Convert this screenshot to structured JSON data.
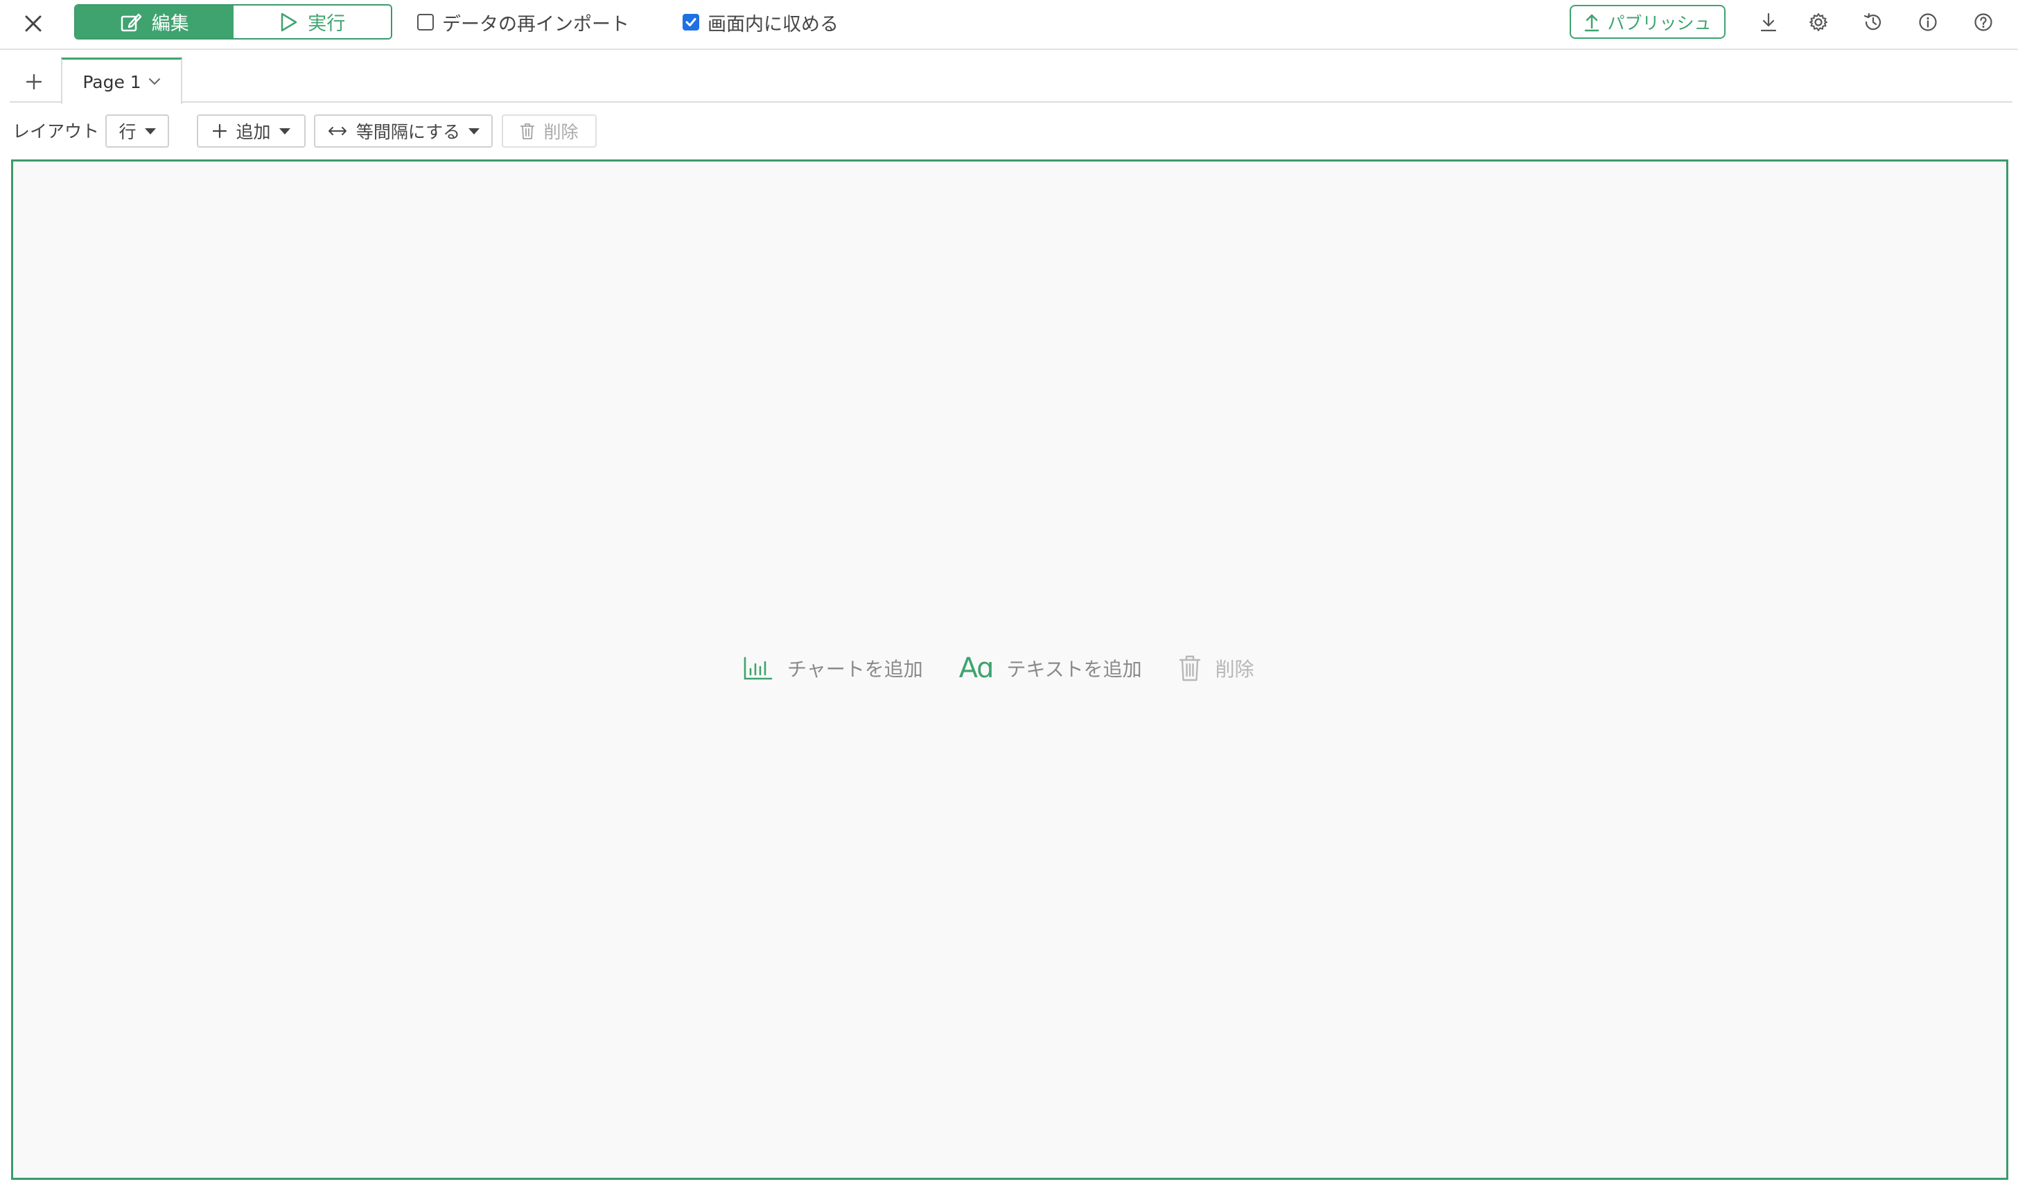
{
  "topbar": {
    "modes": [
      {
        "label": "編集",
        "active": true
      },
      {
        "label": "実行",
        "active": false
      }
    ],
    "reimport_label": "データの再インポート",
    "reimport_checked": false,
    "fit_label": "画面内に収める",
    "fit_checked": true,
    "publish_label": "パブリッシュ",
    "icons": [
      "download-icon",
      "gear-icon",
      "history-icon",
      "info-icon",
      "help-icon"
    ]
  },
  "tabs": {
    "items": [
      {
        "label": "Page 1"
      }
    ]
  },
  "layout_toolbar": {
    "layout_label": "レイアウト",
    "layout_value": "行",
    "add_label": "追加",
    "equal_spacing_label": "等間隔にする",
    "delete_label": "削除"
  },
  "canvas": {
    "add_chart_label": "チャートを追加",
    "add_text_label": "テキストを追加",
    "delete_label": "削除"
  },
  "colors": {
    "accent": "#3fa36f",
    "accent_border": "#3c9a6b",
    "checkbox": "#1f6fe5",
    "canvas_bg": "#f9f9f9"
  }
}
